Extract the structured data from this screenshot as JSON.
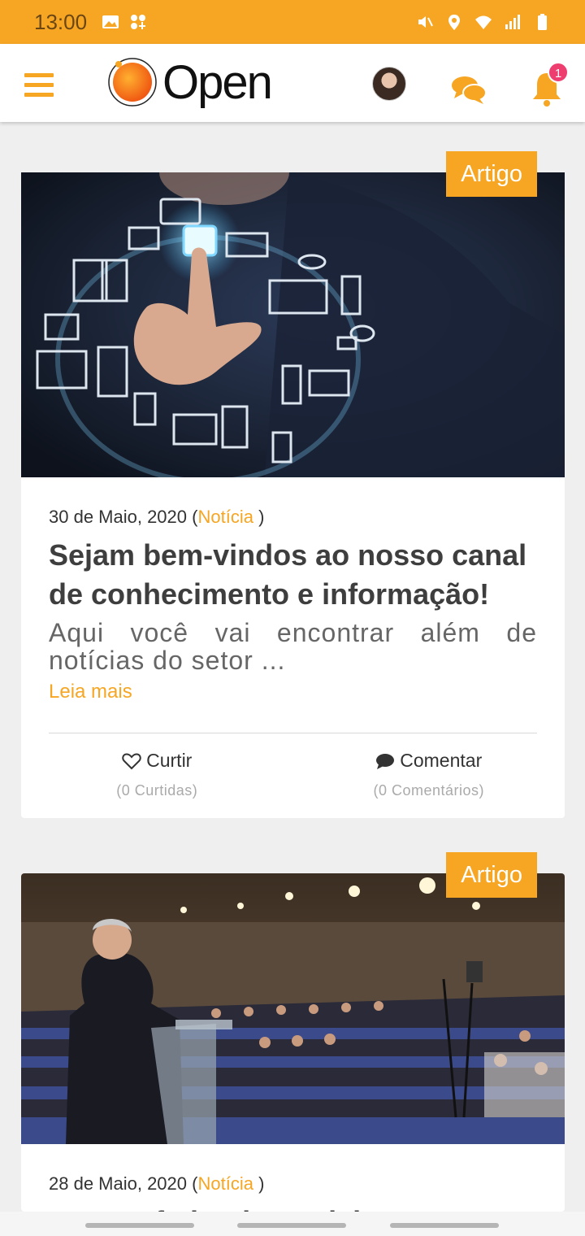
{
  "status_bar": {
    "time": "13:00",
    "left_icons": [
      "image-icon",
      "apps-icon"
    ],
    "right_icons": [
      "mute-icon",
      "location-icon",
      "wifi-icon",
      "signal-icon",
      "battery-icon"
    ]
  },
  "app_bar": {
    "logo_text": "Open",
    "notification_count": "1",
    "icons": [
      "menu-icon",
      "avatar",
      "chat-icon",
      "bell-icon"
    ]
  },
  "colors": {
    "accent": "#f6a623",
    "badge": "#ee3d6f",
    "title": "#3e3e3e"
  },
  "posts": [
    {
      "tag": "Artigo",
      "date": "30 de Maio, 2020",
      "paren_open": "(",
      "category": "Notícia",
      "paren_close": ")",
      "title": "Sejam bem-vindos ao nosso canal de conhecimento e informação!",
      "excerpt": "Aqui você vai encontrar além de notícias do setor ...",
      "read_more": "Leia mais",
      "like_label": "Curtir",
      "like_count": "(0 Curtidas)",
      "comment_label": "Comentar",
      "comment_count": "(0 Comentários)"
    },
    {
      "tag": "Artigo",
      "date": "28 de Maio, 2020",
      "paren_open": "(",
      "category": "Notícia",
      "paren_close": ")",
      "title": "Evento federal traz debates nos"
    }
  ]
}
